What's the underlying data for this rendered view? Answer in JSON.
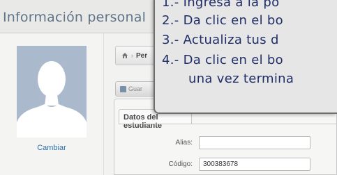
{
  "page": {
    "title": "Información personal"
  },
  "profile": {
    "change_label": "Cambiar"
  },
  "breadcrumb": {
    "label": "Per"
  },
  "toolbar": {
    "save_label": "Guar"
  },
  "tabs": [
    {
      "label": "Datos del estudiante"
    }
  ],
  "form": {
    "alias": {
      "label": "Alias:",
      "value": ""
    },
    "codigo": {
      "label": "Código:",
      "value": "300383678"
    }
  },
  "instructions": {
    "steps": [
      "1.- Ingresa a la po",
      "2.- Da clic en el bo",
      "3.- Actualiza tus d",
      "4.- Da clic en el bo",
      "una vez termina"
    ]
  },
  "colors": {
    "accent_text": "#1f2e67",
    "title": "#5f7488",
    "link": "#2f6fab"
  }
}
